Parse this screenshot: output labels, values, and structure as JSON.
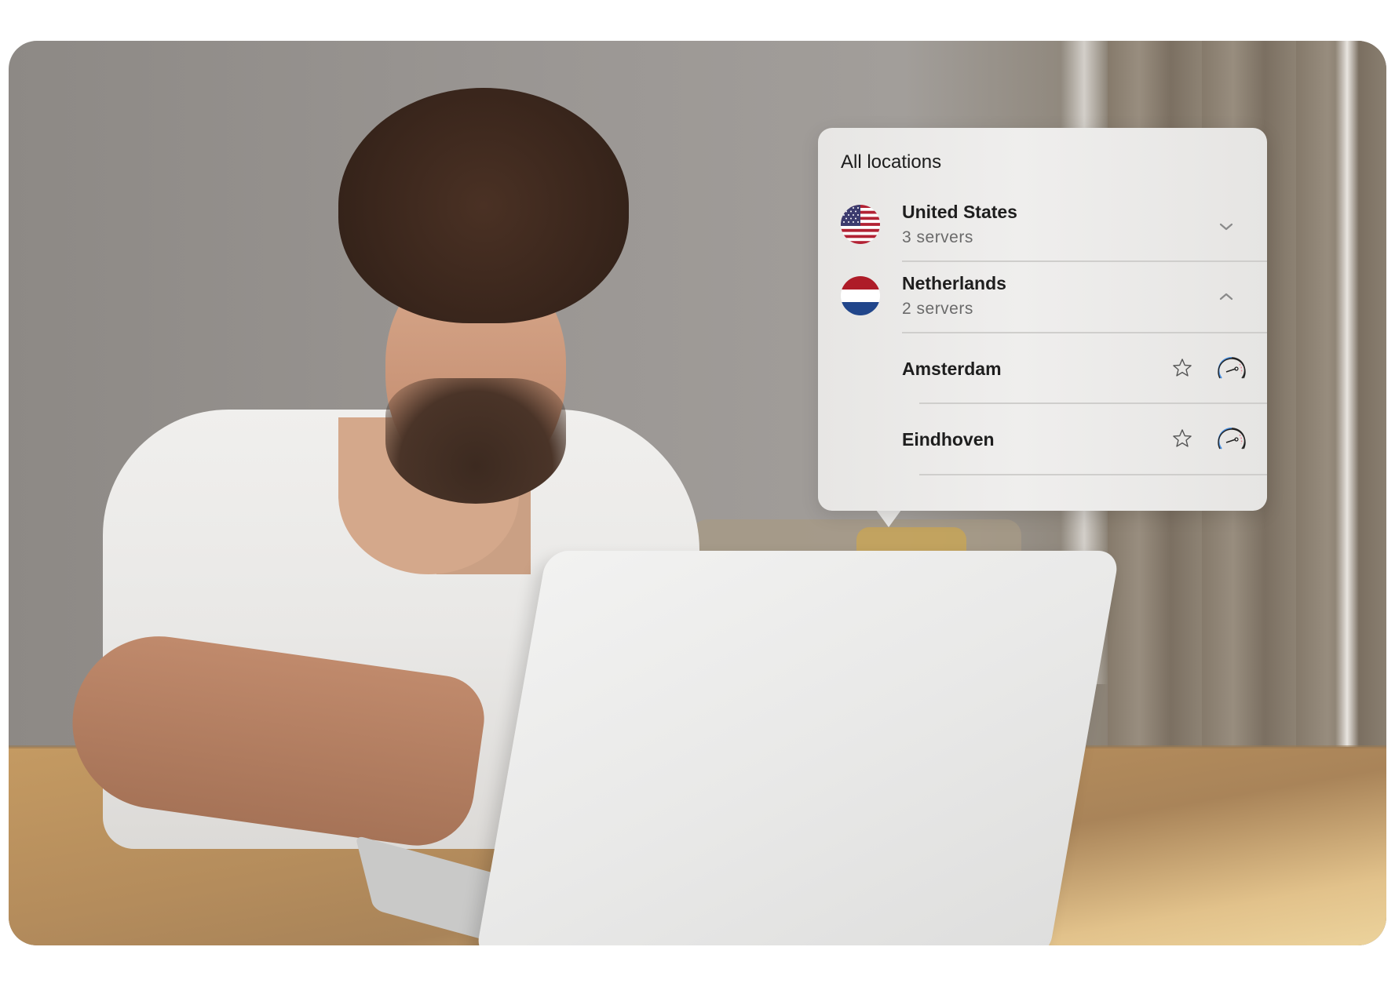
{
  "popup": {
    "title": "All locations",
    "countries": [
      {
        "name": "United States",
        "servers": "3 servers",
        "flag_icon": "us-flag-icon",
        "expanded": false,
        "chevron": "chevron-down-icon"
      },
      {
        "name": "Netherlands",
        "servers": "2 servers",
        "flag_icon": "nl-flag-icon",
        "expanded": true,
        "chevron": "chevron-up-icon",
        "cities": [
          {
            "name": "Amsterdam",
            "favorite": false
          },
          {
            "name": "Eindhoven",
            "favorite": false
          }
        ]
      }
    ]
  },
  "colors": {
    "popup_bg": "#eeedeb",
    "text_primary": "#1e1e1e",
    "text_secondary": "#6a6a6a",
    "divider": "#cfcecc",
    "chevron": "#8a8a8a",
    "gauge_blue": "#4a90e2",
    "gauge_red": "#e88b9b",
    "nl_red": "#ae1c28",
    "nl_blue": "#21468b",
    "us_red": "#b22234",
    "us_blue": "#3c3b6e"
  }
}
